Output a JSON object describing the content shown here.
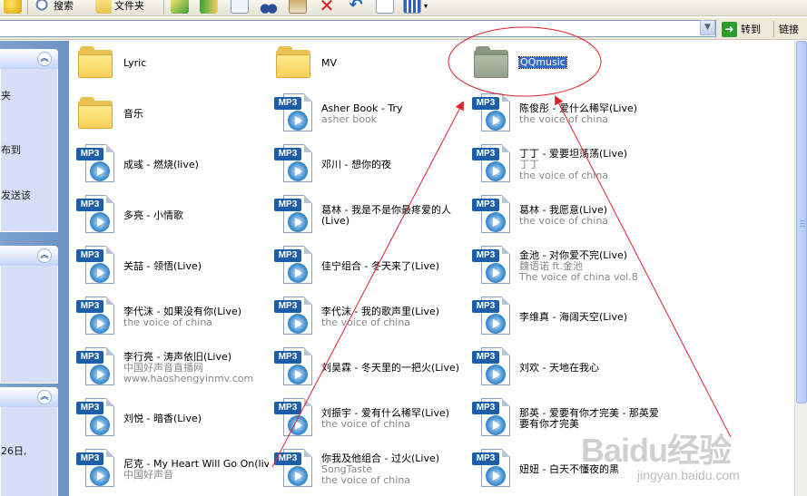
{
  "toolbar": {
    "search_label": "搜索",
    "folders_label": "文件夹"
  },
  "addressbar": {
    "go_label": "转到",
    "links_label": "链接"
  },
  "taskpane": {
    "group1_lines": [
      "夹",
      "布到",
      "发送该"
    ],
    "group3_lines": [
      "26日,"
    ]
  },
  "items": [
    {
      "kind": "folder",
      "title": "Lyric"
    },
    {
      "kind": "folder",
      "title": "MV"
    },
    {
      "kind": "folder",
      "title": "QQmusic",
      "selected": true
    },
    {
      "kind": "folder",
      "title": "音乐"
    },
    {
      "kind": "mp3",
      "title": "Asher Book - Try",
      "sub1": "asher book"
    },
    {
      "kind": "mp3",
      "title": "陈俊彤 - 爱什么稀罕(Live)",
      "sub1": "the voice of china"
    },
    {
      "kind": "mp3",
      "title": "成彧 - 燃烧(live)"
    },
    {
      "kind": "mp3",
      "title": "邓川 - 想你的夜"
    },
    {
      "kind": "mp3",
      "title": "丁丁 - 爱要坦荡荡(Live)",
      "sub1": "丁丁",
      "sub2": "the voice of china"
    },
    {
      "kind": "mp3",
      "title": "多亮 - 小情歌"
    },
    {
      "kind": "mp3",
      "title": "葛林 - 我是不是你最疼爱的人(Live)",
      "wrap": true
    },
    {
      "kind": "mp3",
      "title": "葛林 - 我愿意(Live)",
      "sub1": "the voice of china"
    },
    {
      "kind": "mp3",
      "title": "关喆 - 领悟(Live)"
    },
    {
      "kind": "mp3",
      "title": "佳宁组合 - 冬天来了(Live)"
    },
    {
      "kind": "mp3",
      "title": "金池 - 对你爱不完(Live)",
      "sub1": "魏语诺 ft.金池",
      "sub2": "The voice of china vol.8"
    },
    {
      "kind": "mp3",
      "title": "李代沫 - 如果没有你(Live)",
      "sub1": "the voice of china"
    },
    {
      "kind": "mp3",
      "title": "李代沫 - 我的歌声里(Live)",
      "sub1": "the voice of china"
    },
    {
      "kind": "mp3",
      "title": "李维真 - 海阔天空(Live)"
    },
    {
      "kind": "mp3",
      "title": "李行亮 - 涛声依旧(Live)",
      "sub1": "中国好声音直播网",
      "sub2": "www.haoshengyinmv.com"
    },
    {
      "kind": "mp3",
      "title": "刘昊霖 - 冬天里的一把火(Live)"
    },
    {
      "kind": "mp3",
      "title": "刘欢 - 天地在我心"
    },
    {
      "kind": "mp3",
      "title": "刘悦 - 暗香(Live)"
    },
    {
      "kind": "mp3",
      "title": "刘振宇 - 爱有什么稀罕(Live)",
      "sub1": "the voice of china"
    },
    {
      "kind": "mp3",
      "title": "那英 - 爱要有你才完美 - 那英爱要有你才完美",
      "wrap": true
    },
    {
      "kind": "mp3",
      "title": "尼克 - My Heart Will Go On(live)",
      "sub1": "中国好声音"
    },
    {
      "kind": "mp3",
      "title": "你我及他组合 - 过火(Live)",
      "sub1": "SongTaste",
      "sub2": "the voice of china"
    },
    {
      "kind": "mp3",
      "title": "妞妞 - 白天不懂夜的黑"
    }
  ],
  "icons": {
    "mp3_tag": "MP3"
  },
  "watermark": {
    "logo": "Baidu经验",
    "url": "jingyan.baidu.com"
  },
  "colors": {
    "annotation": "#e0202a",
    "taskpane": "#7da2ce",
    "selection": "#316ac5"
  }
}
